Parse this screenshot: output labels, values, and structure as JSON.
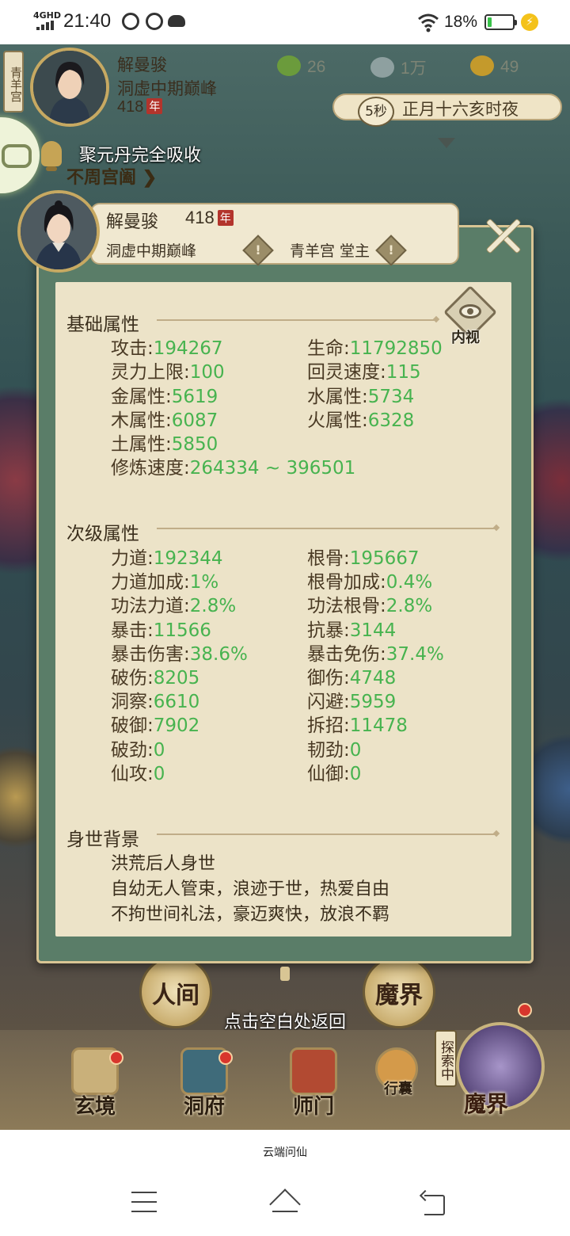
{
  "status_bar": {
    "network": "4GHD",
    "time": "21:40",
    "battery_pct": "18%",
    "battery_level": 0.18
  },
  "hud": {
    "sect_tag": "青羊宫",
    "name": "解曼骏",
    "realm": "洞虚中期巅峰",
    "age": "418",
    "nian": "年",
    "res1": "26",
    "res2": "1万",
    "res3": "49",
    "timer": "5秒",
    "date": "正月十六亥时夜",
    "location_link": "不周宫阖",
    "location_arrow": "❯"
  },
  "notice": "聚元丹完全吸收",
  "profile": {
    "name": "解曼骏",
    "age": "418",
    "nian": "年",
    "realm": "洞虚中期巅峰",
    "sect": "青羊宫 堂主",
    "inner_view": "内视"
  },
  "basic": {
    "title": "基础属性",
    "stats": [
      {
        "label": "攻击:",
        "value": "194267"
      },
      {
        "label": "生命:",
        "value": "11792850"
      },
      {
        "label": "灵力上限:",
        "value": "100"
      },
      {
        "label": "回灵速度:",
        "value": "115"
      },
      {
        "label": "金属性:",
        "value": "5619"
      },
      {
        "label": "水属性:",
        "value": "5734"
      },
      {
        "label": "木属性:",
        "value": "6087"
      },
      {
        "label": "火属性:",
        "value": "6328"
      },
      {
        "label": "土属性:",
        "value": "5850"
      },
      {
        "label": "修炼速度:",
        "value": "264334 ~ 396501"
      }
    ]
  },
  "secondary": {
    "title": "次级属性",
    "stats": [
      {
        "label": "力道:",
        "value": "192344"
      },
      {
        "label": "根骨:",
        "value": "195667"
      },
      {
        "label": "力道加成:",
        "value": "1%"
      },
      {
        "label": "根骨加成:",
        "value": "0.4%"
      },
      {
        "label": "功法力道:",
        "value": "2.8%"
      },
      {
        "label": "功法根骨:",
        "value": "2.8%"
      },
      {
        "label": "暴击:",
        "value": "11566"
      },
      {
        "label": "抗暴:",
        "value": "3144"
      },
      {
        "label": "暴击伤害:",
        "value": "38.6%"
      },
      {
        "label": "暴击免伤:",
        "value": "37.4%"
      },
      {
        "label": "破伤:",
        "value": "8205"
      },
      {
        "label": "御伤:",
        "value": "4748"
      },
      {
        "label": "洞察:",
        "value": "6610"
      },
      {
        "label": "闪避:",
        "value": "5959"
      },
      {
        "label": "破御:",
        "value": "7902"
      },
      {
        "label": "拆招:",
        "value": "11478"
      },
      {
        "label": "破劲:",
        "value": "0"
      },
      {
        "label": "韧劲:",
        "value": "0"
      },
      {
        "label": "仙攻:",
        "value": "0"
      },
      {
        "label": "仙御:",
        "value": "0"
      }
    ]
  },
  "background": {
    "title": "身世背景",
    "lines": [
      "洪荒后人身世",
      "自幼无人管束，浪迹于世，热爱自由",
      "不拘世间礼法，豪迈爽快，放浪不羁"
    ]
  },
  "return_hint": "点击空白处返回",
  "worlds": {
    "human": "人间",
    "demon": "魔界"
  },
  "nav": {
    "items": [
      "玄境",
      "洞府",
      "师门",
      "行囊"
    ],
    "explore": "探索中",
    "demon_big": "魔界"
  },
  "app_title": "云端问仙",
  "colors": {
    "stat_value": "#47b34f",
    "panel_bg": "#ece3c8",
    "panel_frame": "#5a7d68",
    "battery": "#39c24a"
  }
}
